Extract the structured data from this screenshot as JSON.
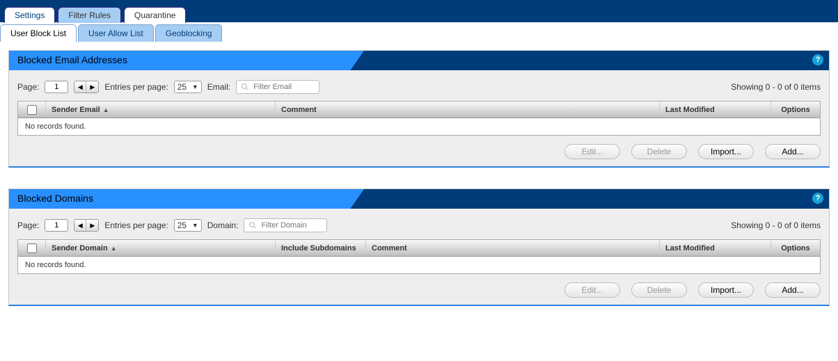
{
  "tabs": {
    "settings": "Settings",
    "filter_rules": "Filter Rules",
    "quarantine": "Quarantine"
  },
  "subtabs": {
    "block_list": "User Block List",
    "allow_list": "User Allow List",
    "geoblocking": "Geoblocking"
  },
  "panels": {
    "emails": {
      "title": "Blocked Email Addresses",
      "page_label": "Page:",
      "page_value": "1",
      "entries_label": "Entries per page:",
      "entries_value": "25",
      "filter_label": "Email:",
      "filter_placeholder": "Filter Email",
      "showing": "Showing 0 - 0 of 0 items",
      "columns": {
        "c1": "Sender Email",
        "c2": "Comment",
        "c3": "Last Modified",
        "c4": "Options"
      },
      "empty": "No records found."
    },
    "domains": {
      "title": "Blocked Domains",
      "page_label": "Page:",
      "page_value": "1",
      "entries_label": "Entries per page:",
      "entries_value": "25",
      "filter_label": "Domain:",
      "filter_placeholder": "Filter Domain",
      "showing": "Showing 0 - 0 of 0 items",
      "columns": {
        "c1": "Sender Domain",
        "c2": "Include Subdomains",
        "c3": "Comment",
        "c4": "Last Modified",
        "c5": "Options"
      },
      "empty": "No records found."
    }
  },
  "buttons": {
    "edit": "Edit...",
    "delete": "Delete",
    "import": "Import...",
    "add": "Add..."
  },
  "help": "?"
}
